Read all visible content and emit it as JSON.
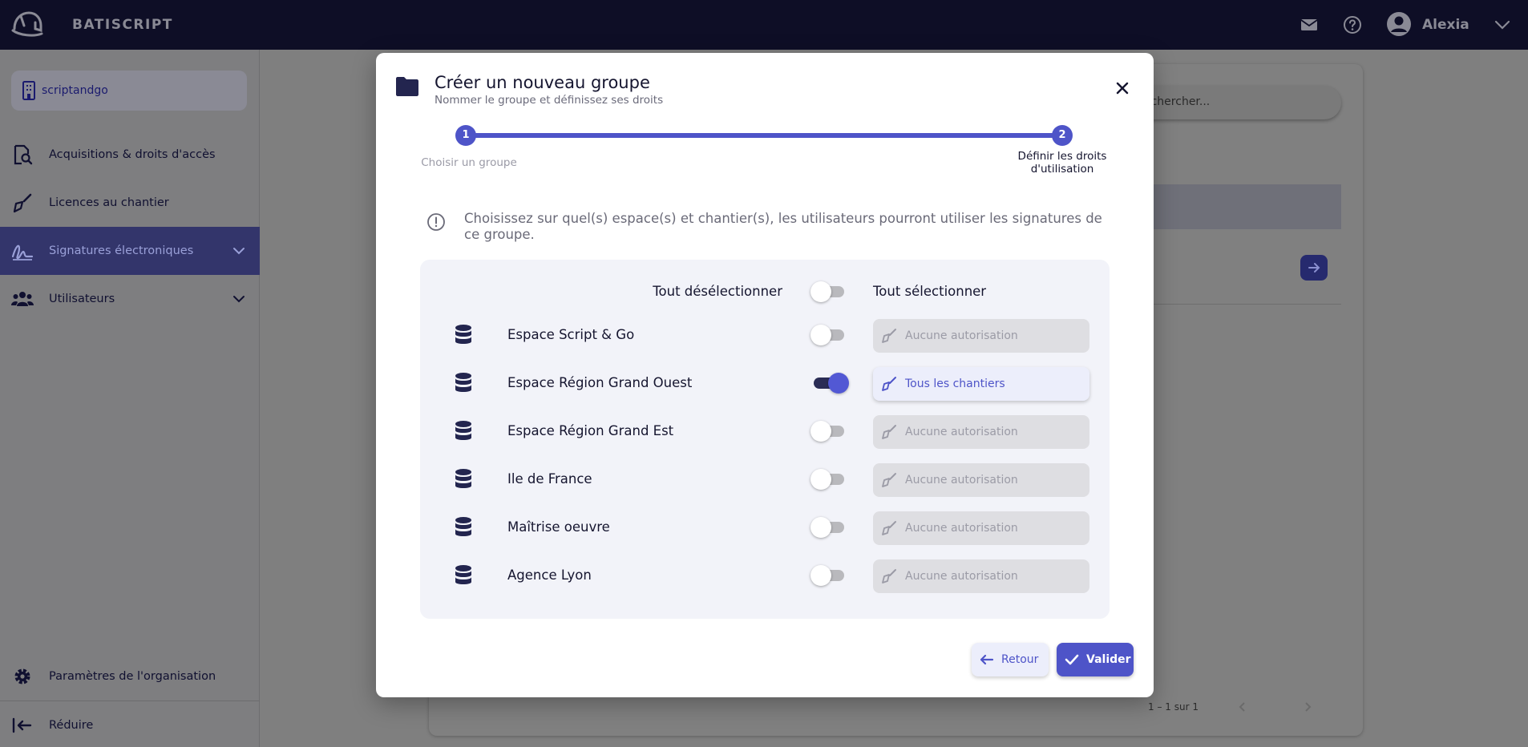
{
  "app": {
    "brand": "BATISCRIPT",
    "username": "Alexia"
  },
  "header": {
    "icons": [
      "mail-icon",
      "help-icon",
      "avatar-icon",
      "chevron-down-icon"
    ]
  },
  "sidebar": {
    "organization": "scriptandgo",
    "items": [
      {
        "label": "Acquisitions & droits d'accès",
        "icon": "document-search-icon",
        "active": false
      },
      {
        "label": "Licences au chantier",
        "icon": "trowel-icon",
        "active": false
      },
      {
        "label": "Signatures électroniques",
        "icon": "signature-icon",
        "active": true
      },
      {
        "label": "Utilisateurs",
        "icon": "users-icon",
        "active": false
      }
    ],
    "settings_label": "Paramètres de l'organisation",
    "collapse_label": "Réduire"
  },
  "background": {
    "search_placeholder": "echercher...",
    "pagination": "1 – 1 sur 1"
  },
  "modal": {
    "title": "Créer un nouveau groupe",
    "subtitle": "Nommer le groupe et définissez ses droits",
    "steps": [
      {
        "number": "1",
        "label": "Choisir un groupe"
      },
      {
        "number": "2",
        "label_line1": "Définir les droits",
        "label_line2": "d'utilisation"
      }
    ],
    "info": "Choisissez sur quel(s) espace(s) et chantier(s), les utilisateurs pourront utiliser les signatures de ce groupe.",
    "deselect_all": "Tout désélectionner",
    "select_all": "Tout sélectionner",
    "spaces": [
      {
        "name": "Espace Script & Go",
        "enabled": false,
        "permission": "Aucune autorisation"
      },
      {
        "name": "Espace Région Grand Ouest",
        "enabled": true,
        "permission": "Tous les chantiers"
      },
      {
        "name": "Espace Région Grand Est",
        "enabled": false,
        "permission": "Aucune autorisation"
      },
      {
        "name": "Ile de France",
        "enabled": false,
        "permission": "Aucune autorisation"
      },
      {
        "name": "Maîtrise oeuvre",
        "enabled": false,
        "permission": "Aucune autorisation"
      },
      {
        "name": "Agence Lyon",
        "enabled": false,
        "permission": "Aucune autorisation"
      }
    ],
    "back_label": "Retour",
    "validate_label": "Valider"
  },
  "colors": {
    "accent": "#4e54c8",
    "topbar": "#0e0e26",
    "toggle_on_track": "#2a2c55"
  }
}
